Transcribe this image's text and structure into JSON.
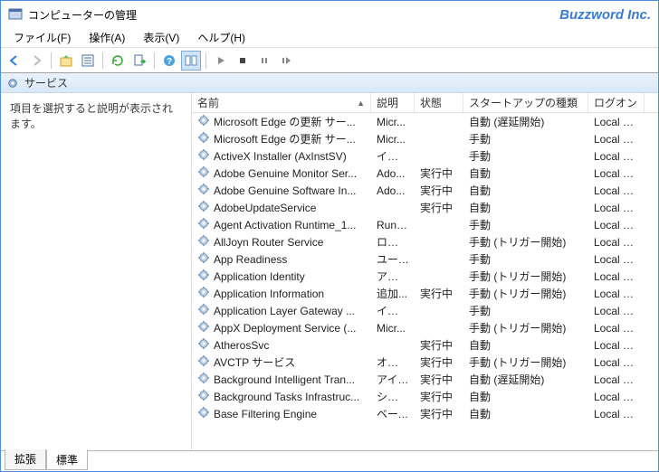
{
  "titlebar": {
    "title": "コンピューターの管理",
    "brand": "Buzzword Inc."
  },
  "menu": {
    "file": "ファイル(F)",
    "action": "操作(A)",
    "view": "表示(V)",
    "help": "ヘルプ(H)"
  },
  "svc_header": "サービス",
  "left_pane": "項目を選択すると説明が表示されます。",
  "columns": {
    "name": "名前",
    "desc": "説明",
    "state": "状態",
    "startup": "スタートアップの種類",
    "logon": "ログオン"
  },
  "rows": [
    {
      "name": "Microsoft Edge の更新 サー...",
      "desc": "Micr...",
      "state": "",
      "startup": "自動 (遅延開始)",
      "logon": "Local S..."
    },
    {
      "name": "Microsoft Edge の更新 サー...",
      "desc": "Micr...",
      "state": "",
      "startup": "手動",
      "logon": "Local S..."
    },
    {
      "name": "ActiveX Installer (AxInstSV)",
      "desc": "インタ...",
      "state": "",
      "startup": "手動",
      "logon": "Local S..."
    },
    {
      "name": "Adobe Genuine Monitor Ser...",
      "desc": "Ado...",
      "state": "実行中",
      "startup": "自動",
      "logon": "Local S..."
    },
    {
      "name": "Adobe Genuine Software In...",
      "desc": "Ado...",
      "state": "実行中",
      "startup": "自動",
      "logon": "Local S..."
    },
    {
      "name": "AdobeUpdateService",
      "desc": "",
      "state": "実行中",
      "startup": "自動",
      "logon": "Local S..."
    },
    {
      "name": "Agent Activation Runtime_1...",
      "desc": "Runti...",
      "state": "",
      "startup": "手動",
      "logon": "Local S..."
    },
    {
      "name": "AllJoyn Router Service",
      "desc": "ローカ...",
      "state": "",
      "startup": "手動 (トリガー開始)",
      "logon": "Local S..."
    },
    {
      "name": "App Readiness",
      "desc": "ユーザ...",
      "state": "",
      "startup": "手動",
      "logon": "Local S..."
    },
    {
      "name": "Application Identity",
      "desc": "アプリ...",
      "state": "",
      "startup": "手動 (トリガー開始)",
      "logon": "Local S..."
    },
    {
      "name": "Application Information",
      "desc": "追加...",
      "state": "実行中",
      "startup": "手動 (トリガー開始)",
      "logon": "Local S..."
    },
    {
      "name": "Application Layer Gateway ...",
      "desc": "インタ...",
      "state": "",
      "startup": "手動",
      "logon": "Local S..."
    },
    {
      "name": "AppX Deployment Service (...",
      "desc": "Micr...",
      "state": "",
      "startup": "手動 (トリガー開始)",
      "logon": "Local S..."
    },
    {
      "name": "AtherosSvc",
      "desc": "",
      "state": "実行中",
      "startup": "自動",
      "logon": "Local S..."
    },
    {
      "name": "AVCTP サービス",
      "desc": "オーデ...",
      "state": "実行中",
      "startup": "手動 (トリガー開始)",
      "logon": "Local S..."
    },
    {
      "name": "Background Intelligent Tran...",
      "desc": "アイド...",
      "state": "実行中",
      "startup": "自動 (遅延開始)",
      "logon": "Local S..."
    },
    {
      "name": "Background Tasks Infrastruc...",
      "desc": "システ...",
      "state": "実行中",
      "startup": "自動",
      "logon": "Local S..."
    },
    {
      "name": "Base Filtering Engine",
      "desc": "ベース...",
      "state": "実行中",
      "startup": "自動",
      "logon": "Local S..."
    }
  ],
  "tabs": {
    "extended": "拡張",
    "standard": "標準"
  }
}
